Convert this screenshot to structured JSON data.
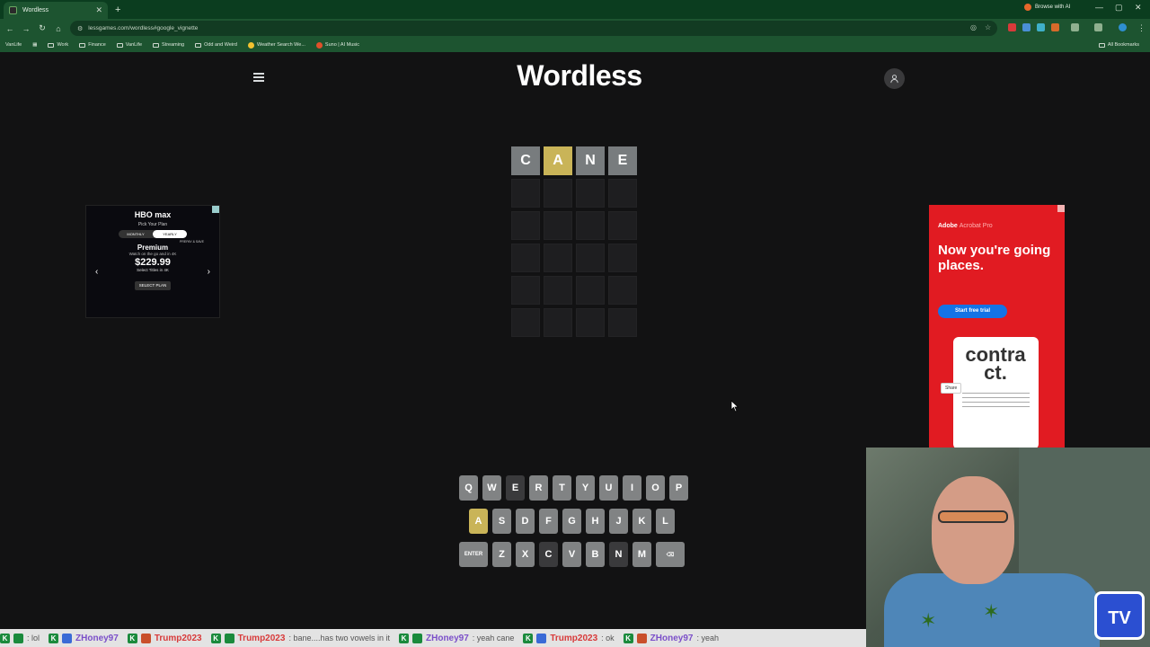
{
  "browser": {
    "tab_title": "Wordless",
    "url": "lessgames.com/wordless#google_vignette",
    "browse_ai": "Browse with AI",
    "bookmarks": [
      "VanLife",
      "Work",
      "Finance",
      "VanLife",
      "Streaming",
      "Odd and Weird",
      "Weather Search We...",
      "Suno | AI Music"
    ],
    "all_bookmarks": "All Bookmarks"
  },
  "game": {
    "title": "Wordless",
    "board": [
      [
        {
          "l": "C",
          "s": "absent"
        },
        {
          "l": "A",
          "s": "present"
        },
        {
          "l": "N",
          "s": "absent"
        },
        {
          "l": "E",
          "s": "absent"
        }
      ],
      [
        {
          "l": "",
          "s": "empty"
        },
        {
          "l": "",
          "s": "empty"
        },
        {
          "l": "",
          "s": "empty"
        },
        {
          "l": "",
          "s": "empty"
        }
      ],
      [
        {
          "l": "",
          "s": "empty"
        },
        {
          "l": "",
          "s": "empty"
        },
        {
          "l": "",
          "s": "empty"
        },
        {
          "l": "",
          "s": "empty"
        }
      ],
      [
        {
          "l": "",
          "s": "empty"
        },
        {
          "l": "",
          "s": "empty"
        },
        {
          "l": "",
          "s": "empty"
        },
        {
          "l": "",
          "s": "empty"
        }
      ],
      [
        {
          "l": "",
          "s": "empty"
        },
        {
          "l": "",
          "s": "empty"
        },
        {
          "l": "",
          "s": "empty"
        },
        {
          "l": "",
          "s": "empty"
        }
      ],
      [
        {
          "l": "",
          "s": "empty"
        },
        {
          "l": "",
          "s": "empty"
        },
        {
          "l": "",
          "s": "empty"
        },
        {
          "l": "",
          "s": "empty"
        }
      ]
    ],
    "keyboard": [
      [
        {
          "k": "Q"
        },
        {
          "k": "W"
        },
        {
          "k": "E",
          "s": "absent"
        },
        {
          "k": "R"
        },
        {
          "k": "T"
        },
        {
          "k": "Y"
        },
        {
          "k": "U"
        },
        {
          "k": "I"
        },
        {
          "k": "O"
        },
        {
          "k": "P"
        }
      ],
      [
        {
          "k": "A",
          "s": "present"
        },
        {
          "k": "S"
        },
        {
          "k": "D"
        },
        {
          "k": "F"
        },
        {
          "k": "G"
        },
        {
          "k": "H"
        },
        {
          "k": "J"
        },
        {
          "k": "K"
        },
        {
          "k": "L"
        }
      ],
      [
        {
          "k": "ENTER",
          "wide": true
        },
        {
          "k": "Z"
        },
        {
          "k": "X"
        },
        {
          "k": "C",
          "s": "absent"
        },
        {
          "k": "V"
        },
        {
          "k": "B"
        },
        {
          "k": "N",
          "s": "absent"
        },
        {
          "k": "M"
        },
        {
          "k": "⌫",
          "wide": true
        }
      ]
    ],
    "colors": {
      "absent": "#787c7e",
      "present": "#c9b458",
      "key": "#818384",
      "background": "#121213"
    }
  },
  "ad_left": {
    "brand": "HBO max",
    "pick": "Pick Your Plan",
    "toggle": [
      "MONTHLY",
      "YEARLY",
      "PREPAY & SAVE"
    ],
    "tier": "Premium",
    "sub": "Watch on the go and in 4K",
    "price": "$229.99",
    "titles": "Select Titles in 4K",
    "cta": "SELECT PLAN"
  },
  "ad_right": {
    "brand": "Adobe",
    "product": "Acrobat Pro",
    "headline": "Now you're going places.",
    "cta": "Start free trial",
    "doc_word": "contract.",
    "share": "Share"
  },
  "ticker": [
    {
      "user": "",
      "msg": ": lol"
    },
    {
      "user": "ZHoney97",
      "msg": ""
    },
    {
      "user": "Trump2023",
      "msg": ""
    },
    {
      "user": "Trump2023",
      "msg": ": bane....has two vowels in it"
    },
    {
      "user": "ZHoney97",
      "msg": ": yeah cane"
    },
    {
      "user": "Trump2023",
      "msg": ": ok"
    },
    {
      "user": "ZHoney97",
      "msg": ": yeah"
    }
  ]
}
